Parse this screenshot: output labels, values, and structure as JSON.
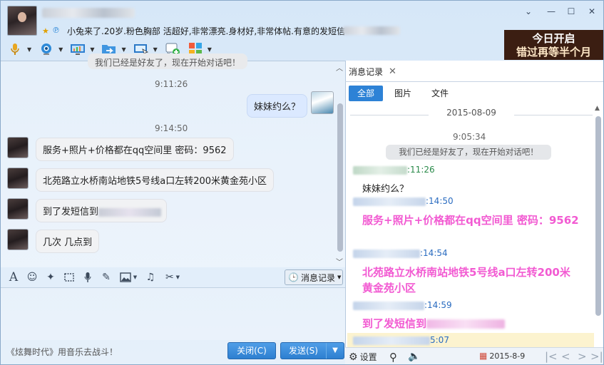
{
  "titlebar": {
    "signature": "小兔来了.20岁.粉色胸部 活超好,非常漂亮.身材好,非常体帖.有意的发短信",
    "ad": {
      "line1": "今日开启",
      "line2": "错过再等半个月"
    }
  },
  "toolbar": {
    "icons": [
      "microphone-icon",
      "video-camera-icon",
      "screen-share-icon",
      "file-transfer-icon",
      "remote-desktop-icon",
      "add-member-icon",
      "apps-icon"
    ]
  },
  "chat": {
    "top_cut_message": "我们已经是好友了，现在开始对话吧！",
    "messages": [
      {
        "time": "9:11:26"
      },
      {
        "from": "me",
        "text": "妹妹约么？"
      },
      {
        "time": "9:14:50"
      },
      {
        "from": "other",
        "text": "服务+照片+价格都在qq空间里 密码：9562"
      },
      {
        "from": "other",
        "text": "北苑路立水桥南站地铁5号线a口左转200米黄金苑小区"
      },
      {
        "from": "other",
        "text": "到了发短信到"
      },
      {
        "from": "other",
        "text": "几次 几点到"
      }
    ]
  },
  "input_toolbar": {
    "icons": [
      "font-icon",
      "emoji-icon",
      "magic-icon",
      "screenshot-icon",
      "voice-icon",
      "edit-icon",
      "image-icon",
      "music-icon",
      "scissors-icon"
    ],
    "history_label": "消息记录"
  },
  "footer": {
    "tip": "《炫舞时代》用音乐去战斗！",
    "close_label": "关闭(C)",
    "send_label": "发送(S)"
  },
  "history_panel": {
    "tab_label": "消息记录",
    "filters": [
      "全部",
      "图片",
      "文件"
    ],
    "date": "2015-08-09",
    "first_time": "9:05:34",
    "system_message": "我们已经是好友了，现在开始对话吧！",
    "entries": [
      {
        "time": ":11:26",
        "color": "green",
        "text": "妹妹约么？",
        "style": "normal"
      },
      {
        "time": ":14:50",
        "color": "blue",
        "text": "服务+照片+价格都在qq空间里 密码：9562",
        "style": "pink"
      },
      {
        "time": ":14:54",
        "color": "blue",
        "text": "北苑路立水桥南站地铁5号线a口左转200米黄金苑小区",
        "style": "pink"
      },
      {
        "time": ":14:59",
        "color": "blue",
        "text": "到了发短信到",
        "style": "pink"
      },
      {
        "time": "5:07",
        "color": "blue",
        "text": "",
        "style": "normal"
      }
    ],
    "footer": {
      "settings_label": "设置",
      "date_label": "2015-8-9"
    }
  },
  "colors": {
    "accent": "#2d82d6",
    "pink_text": "#f25ad2",
    "ad_bg": "#3b1e12"
  }
}
